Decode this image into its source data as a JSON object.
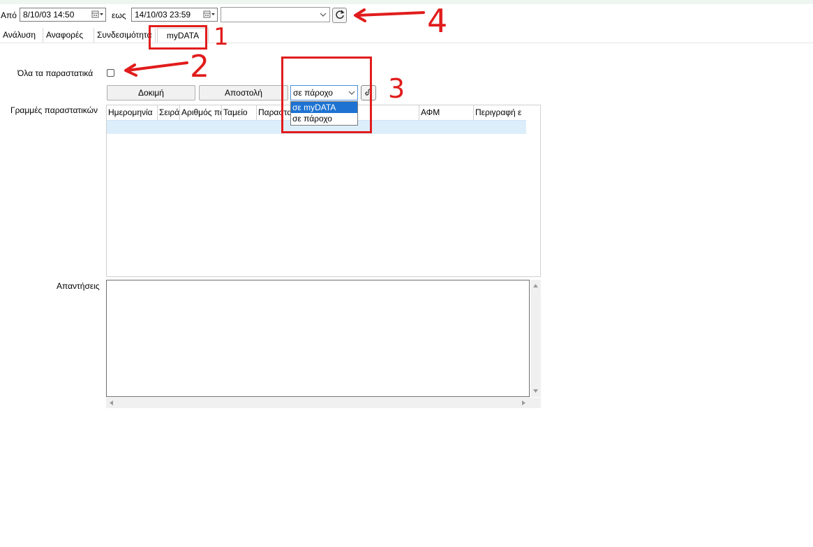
{
  "filter": {
    "from_label": "Από",
    "from_value": "8/10/03 14:50",
    "to_label": "εως",
    "to_value": "14/10/03 23:59",
    "combo_value": "",
    "icons": {
      "calendar": "calendar-icon",
      "chevron": "chevron-down-icon",
      "refresh": "refresh-icon"
    }
  },
  "tabs": [
    {
      "label": "Ανάλυση"
    },
    {
      "label": "Αναφορές"
    },
    {
      "label": "Συνδεσιμότητα"
    },
    {
      "label": "myDATA",
      "active": true
    }
  ],
  "mydata": {
    "all_docs_label": "Όλα τα παραστατικά",
    "all_docs_checked": false,
    "test_button": "Δοκιμή",
    "send_button": "Αποστολή",
    "destination": {
      "selected": "σε πάροχο",
      "options": [
        "σε myDATA",
        "σε πάροχο"
      ],
      "highlighted": "σε myDATA"
    },
    "lines_label": "Γραμμές παραστατικών",
    "columns": [
      "Ημερομηνία",
      "Σειρά",
      "Αριθμός παραστατικού",
      "Ταμείο",
      "Παραστατικό",
      "",
      "ΑΦΜ",
      "Περιγραφή ε"
    ],
    "responses_label": "Απαντήσεις",
    "responses_value": ""
  },
  "annotations": [
    {
      "number": "1",
      "color": "#e11c1c"
    },
    {
      "number": "2",
      "color": "#e11c1c"
    },
    {
      "number": "3",
      "color": "#e11c1c"
    },
    {
      "number": "4",
      "color": "#e11c1c"
    }
  ]
}
